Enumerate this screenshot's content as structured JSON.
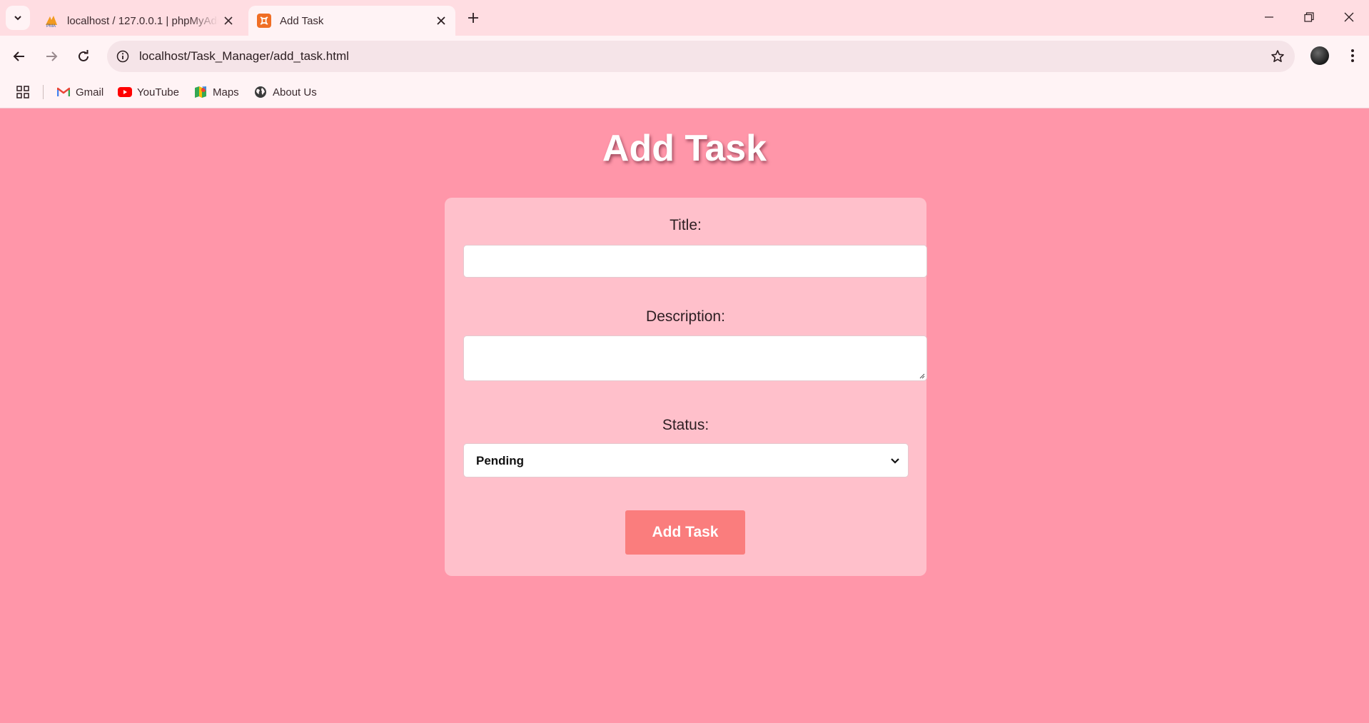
{
  "browser": {
    "tabs": [
      {
        "title": "localhost / 127.0.0.1 | phpMyAdmin",
        "active": false
      },
      {
        "title": "Add Task",
        "active": true
      }
    ],
    "url": "localhost/Task_Manager/add_task.html",
    "bookmarks": [
      {
        "label": "Gmail",
        "icon": "gmail-icon"
      },
      {
        "label": "YouTube",
        "icon": "youtube-icon"
      },
      {
        "label": "Maps",
        "icon": "maps-icon"
      },
      {
        "label": "About Us",
        "icon": "globe-icon"
      }
    ]
  },
  "page": {
    "heading": "Add Task",
    "form": {
      "title_label": "Title:",
      "title_value": "",
      "description_label": "Description:",
      "description_value": "",
      "status_label": "Status:",
      "status_value": "Pending",
      "submit_label": "Add Task"
    }
  },
  "colors": {
    "page_background": "#ff96a9",
    "card_background": "#ffc0cb",
    "button": "#fa7d7d"
  }
}
